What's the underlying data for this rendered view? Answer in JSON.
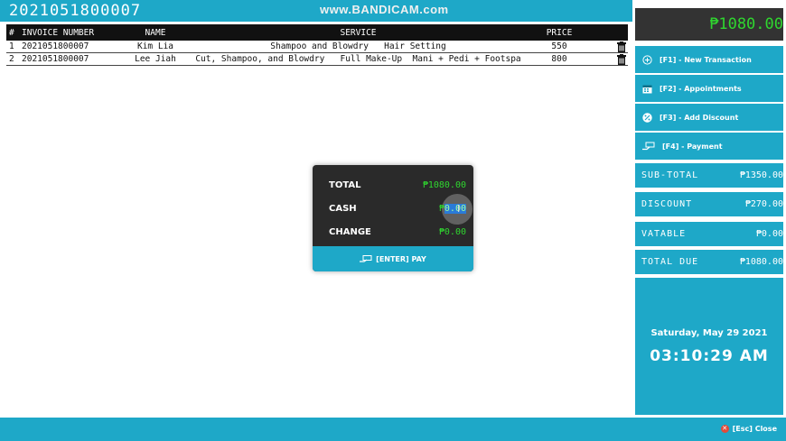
{
  "header": {
    "invoice_title": "2021051800007",
    "watermark": "www.BANDICAM.com"
  },
  "table": {
    "columns": [
      "#",
      "INVOICE NUMBER",
      "NAME",
      "SERVICE",
      "PRICE"
    ],
    "rows": [
      {
        "num": "1",
        "invoice": "2021051800007",
        "name": "Kim Lia",
        "service": "Shampoo and Blowdry   Hair Setting",
        "price": "550"
      },
      {
        "num": "2",
        "invoice": "2021051800007",
        "name": "Lee Jiah",
        "service": "Cut, Shampoo, and Blowdry   Full Make-Up  Mani + Pedi + Footspa",
        "price": "800"
      }
    ]
  },
  "payment_modal": {
    "total_label": "TOTAL",
    "total_value": "₱1080.00",
    "cash_label": "CASH",
    "cash_prefix": "₱",
    "cash_value": "0.00",
    "change_label": "CHANGE",
    "change_value": "₱0.00",
    "pay_label": "[ENTER] PAY"
  },
  "sidebar": {
    "total_display": "₱1080.00",
    "buttons": [
      {
        "label": "[F1] - New Transaction",
        "icon": "plus-circle-icon"
      },
      {
        "label": "[F2] - Appointments",
        "icon": "calendar-icon"
      },
      {
        "label": "[F3] - Add Discount",
        "icon": "percent-icon"
      },
      {
        "label": "[F4] - Payment",
        "icon": "cash-hand-icon"
      }
    ],
    "summary": [
      {
        "label": "SUB-TOTAL",
        "value": "₱1350.00"
      },
      {
        "label": "DISCOUNT",
        "value": "₱270.00"
      },
      {
        "label": "VATABLE",
        "value": "₱0.00"
      },
      {
        "label": "TOTAL DUE",
        "value": "₱1080.00"
      }
    ],
    "date": "Saturday, May 29 2021",
    "time": "03:10:29 AM"
  },
  "footer": {
    "close_label": "[Esc] Close"
  },
  "colors": {
    "accent": "#1ea8c8",
    "dark": "#2a2a2a",
    "money_green": "#2fd62f",
    "close_red": "#e24a3a"
  }
}
